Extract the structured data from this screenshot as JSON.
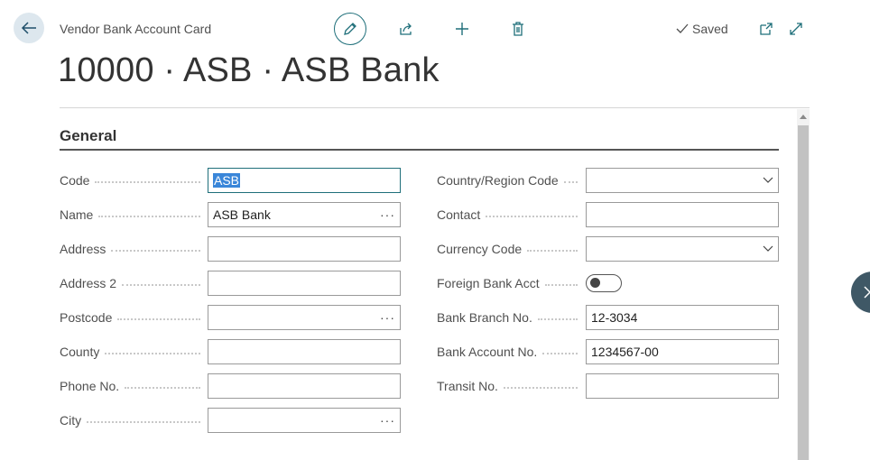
{
  "header": {
    "page_type": "Vendor Bank Account Card",
    "title": "10000 · ASB · ASB Bank",
    "status": "Saved"
  },
  "icons": {
    "back": "arrow-left-icon",
    "edit": "pencil-icon",
    "share": "share-icon",
    "new": "plus-icon",
    "delete": "trash-icon",
    "saved": "checkmark-icon",
    "open_new_window": "open-in-new-window-icon",
    "expand": "expand-icon"
  },
  "section": {
    "title": "General"
  },
  "left_fields": [
    {
      "label": "Code",
      "value": "ASB",
      "selected": true
    },
    {
      "label": "Name",
      "value": "ASB Bank",
      "lookup": true
    },
    {
      "label": "Address",
      "value": ""
    },
    {
      "label": "Address 2",
      "value": ""
    },
    {
      "label": "Postcode",
      "value": "",
      "lookup": true
    },
    {
      "label": "County",
      "value": ""
    },
    {
      "label": "Phone No.",
      "value": ""
    },
    {
      "label": "City",
      "value": "",
      "lookup": true
    }
  ],
  "right_fields": [
    {
      "label": "Country/Region Code",
      "value": "",
      "dropdown": true
    },
    {
      "label": "Contact",
      "value": ""
    },
    {
      "label": "Currency Code",
      "value": "",
      "dropdown": true
    },
    {
      "label": "Foreign Bank Acct",
      "value": "",
      "toggle": true,
      "toggle_on": false
    },
    {
      "label": "Bank Branch No.",
      "value": "12-3034"
    },
    {
      "label": "Bank Account No.",
      "value": "1234567-00"
    },
    {
      "label": "Transit No.",
      "value": ""
    }
  ],
  "lookup_glyph": "···",
  "colors": {
    "accent": "#1f6f7a",
    "selection": "#3a86d9",
    "side_button": "#3f5866"
  }
}
